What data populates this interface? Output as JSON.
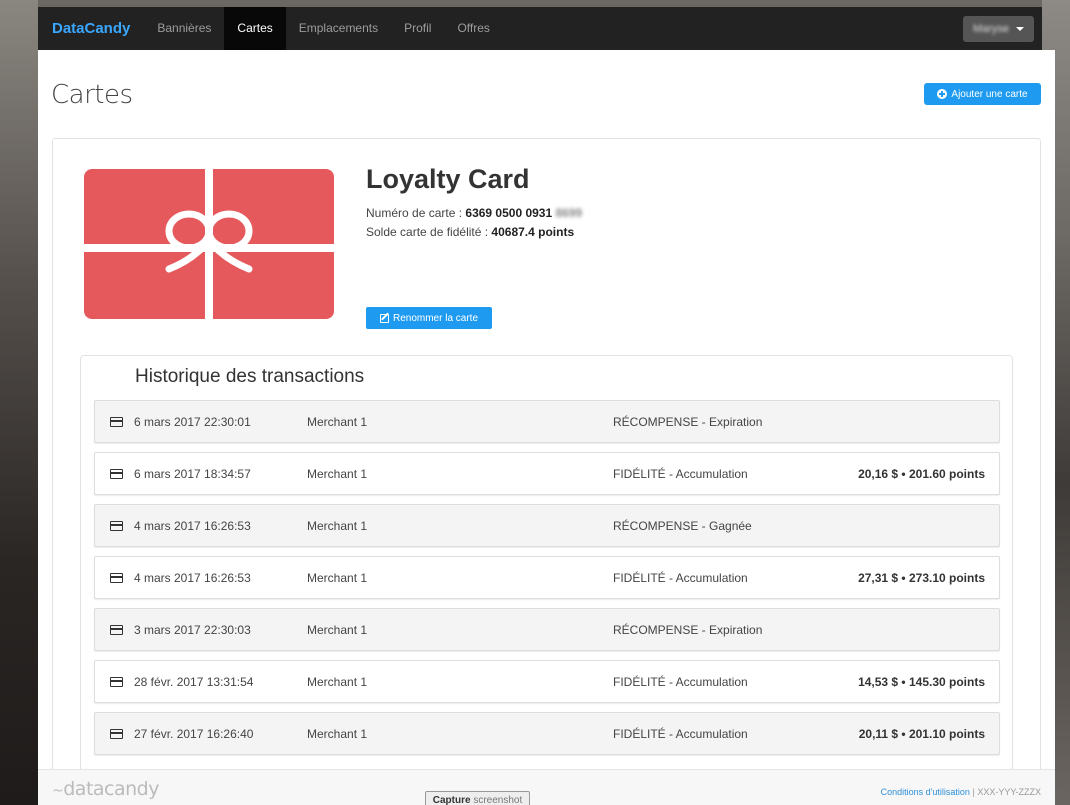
{
  "nav": {
    "brand": "DataCandy",
    "items": [
      {
        "label": "Bannières"
      },
      {
        "label": "Cartes"
      },
      {
        "label": "Emplacements"
      },
      {
        "label": "Profil"
      },
      {
        "label": "Offres"
      }
    ],
    "user_name": "Maryse"
  },
  "page": {
    "title": "Cartes",
    "add_card_label": "Ajouter une carte"
  },
  "card": {
    "name": "Loyalty Card",
    "number_label": "Numéro de carte :",
    "number_value": "6369 0500 0931",
    "number_hidden": "8699",
    "balance_label": "Solde carte de fidélité :",
    "balance_value": "40687.4 points",
    "rename_label": "Renommer la carte"
  },
  "history": {
    "title": "Historique des transactions",
    "rows": [
      {
        "date": "6 mars 2017 22:30:01",
        "merchant": "Merchant 1",
        "type": "RÉCOMPENSE - Expiration",
        "amount": ""
      },
      {
        "date": "6 mars 2017 18:34:57",
        "merchant": "Merchant 1",
        "type": "FIDÉLITÉ - Accumulation",
        "amount": "20,16 $ • 201.60 points"
      },
      {
        "date": "4 mars 2017 16:26:53",
        "merchant": "Merchant 1",
        "type": "RÉCOMPENSE - Gagnée",
        "amount": ""
      },
      {
        "date": "4 mars 2017 16:26:53",
        "merchant": "Merchant 1",
        "type": "FIDÉLITÉ - Accumulation",
        "amount": "27,31 $ • 273.10 points"
      },
      {
        "date": "3 mars 2017 22:30:03",
        "merchant": "Merchant 1",
        "type": "RÉCOMPENSE - Expiration",
        "amount": ""
      },
      {
        "date": "28 févr. 2017 13:31:54",
        "merchant": "Merchant 1",
        "type": "FIDÉLITÉ - Accumulation",
        "amount": "14,53 $ • 145.30 points"
      },
      {
        "date": "27 févr. 2017 16:26:40",
        "merchant": "Merchant 1",
        "type": "FIDÉLITÉ - Accumulation",
        "amount": "20,11 $ • 201.10 points"
      }
    ]
  },
  "footer": {
    "logo": "datacandy",
    "capture_bold": "Capture",
    "capture_light": "screenshot",
    "terms": "Conditions d'utilisation",
    "separator": "|",
    "code": "XXX-YYY-ZZZX"
  },
  "colors": {
    "brand": "#3aa7ff",
    "primary_button": "#1e9bf0",
    "gift_card": "#e5595c",
    "navbar": "#222222"
  }
}
